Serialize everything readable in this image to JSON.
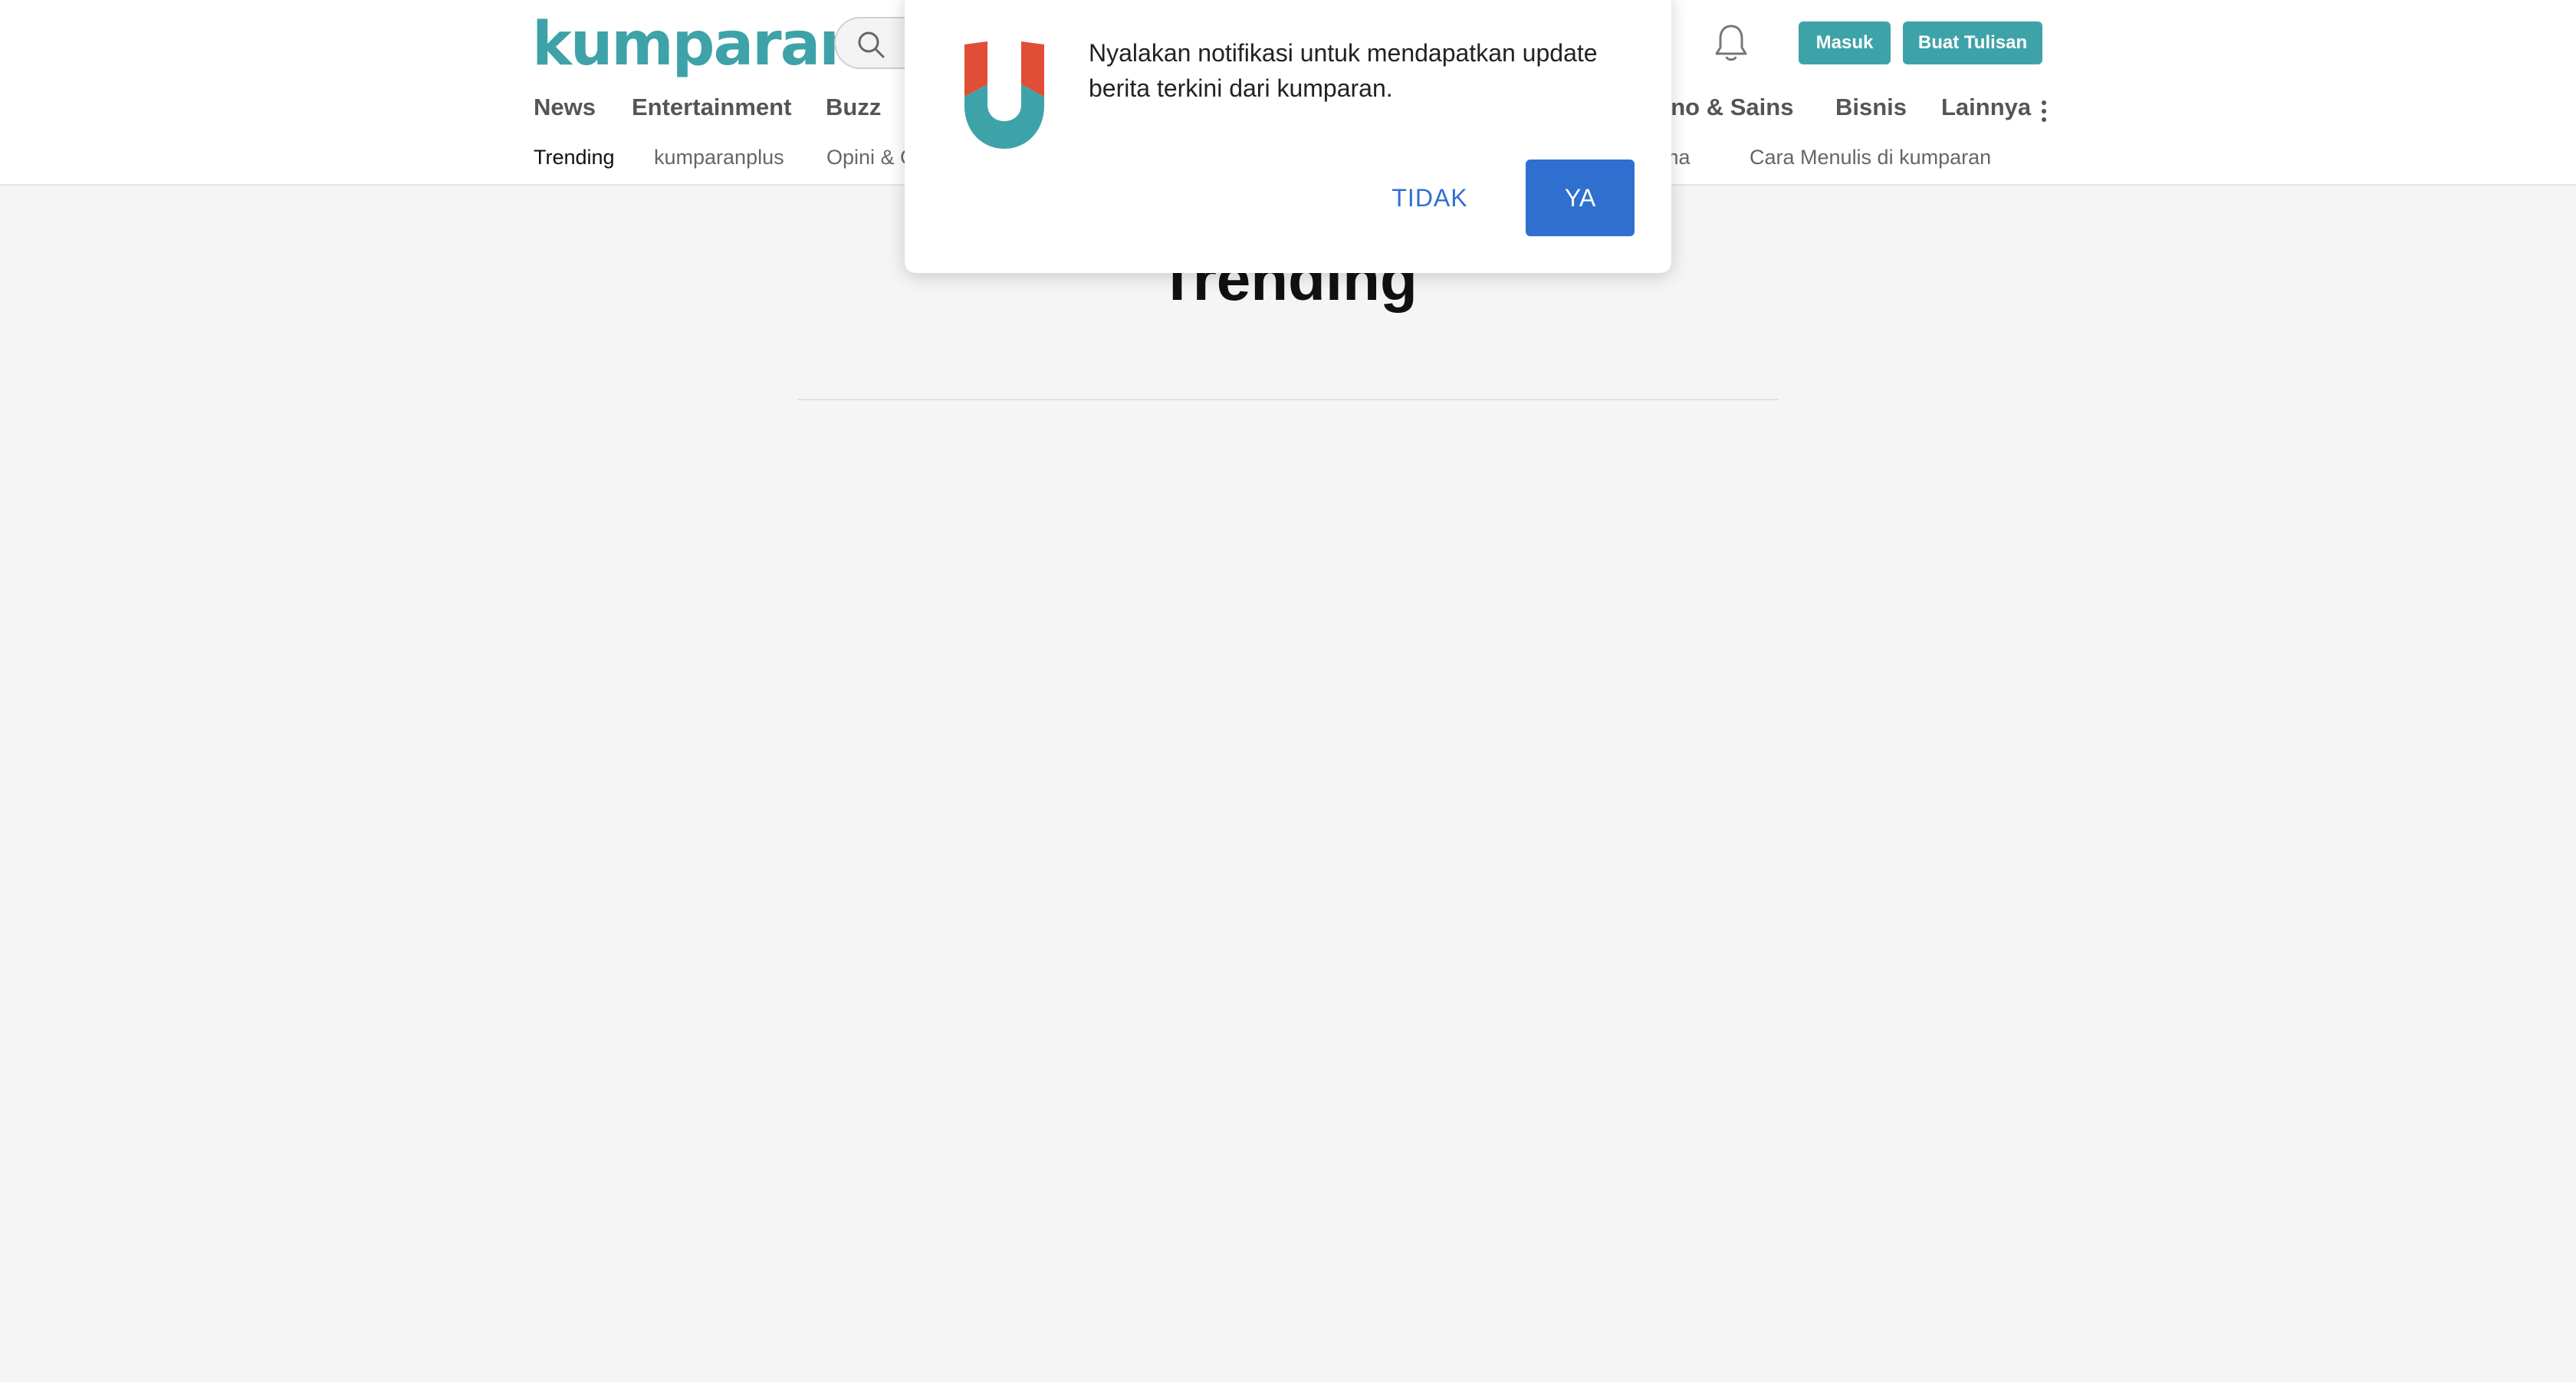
{
  "header": {
    "logo_text": "kumparan",
    "brand_color": "#3ea3a8",
    "login_label": "Masuk",
    "write_label": "Buat Tulisan"
  },
  "nav": {
    "items": [
      {
        "label": "News"
      },
      {
        "label": "Entertainment"
      },
      {
        "label": "Buzz"
      },
      {
        "label": "kno & Sains"
      },
      {
        "label": "Bisnis"
      },
      {
        "label": "Lainnya"
      }
    ]
  },
  "subnav": {
    "items": [
      {
        "label": "Trending",
        "active": true
      },
      {
        "label": "kumparanplus"
      },
      {
        "label": "Opini & C"
      },
      {
        "label": "ama"
      },
      {
        "label": "Cara Menulis di kumparan"
      }
    ]
  },
  "main": {
    "title": "Trending"
  },
  "notification": {
    "message": "Nyalakan notifikasi untuk mendapatkan update berita terkini dari kumparan.",
    "decline_label": "TIDAK",
    "accept_label": "YA",
    "accent_color": "#2f6fcf"
  },
  "icons": [
    "search-icon",
    "bell-icon",
    "more-vertical-icon",
    "kumparan-u-logo-icon"
  ]
}
